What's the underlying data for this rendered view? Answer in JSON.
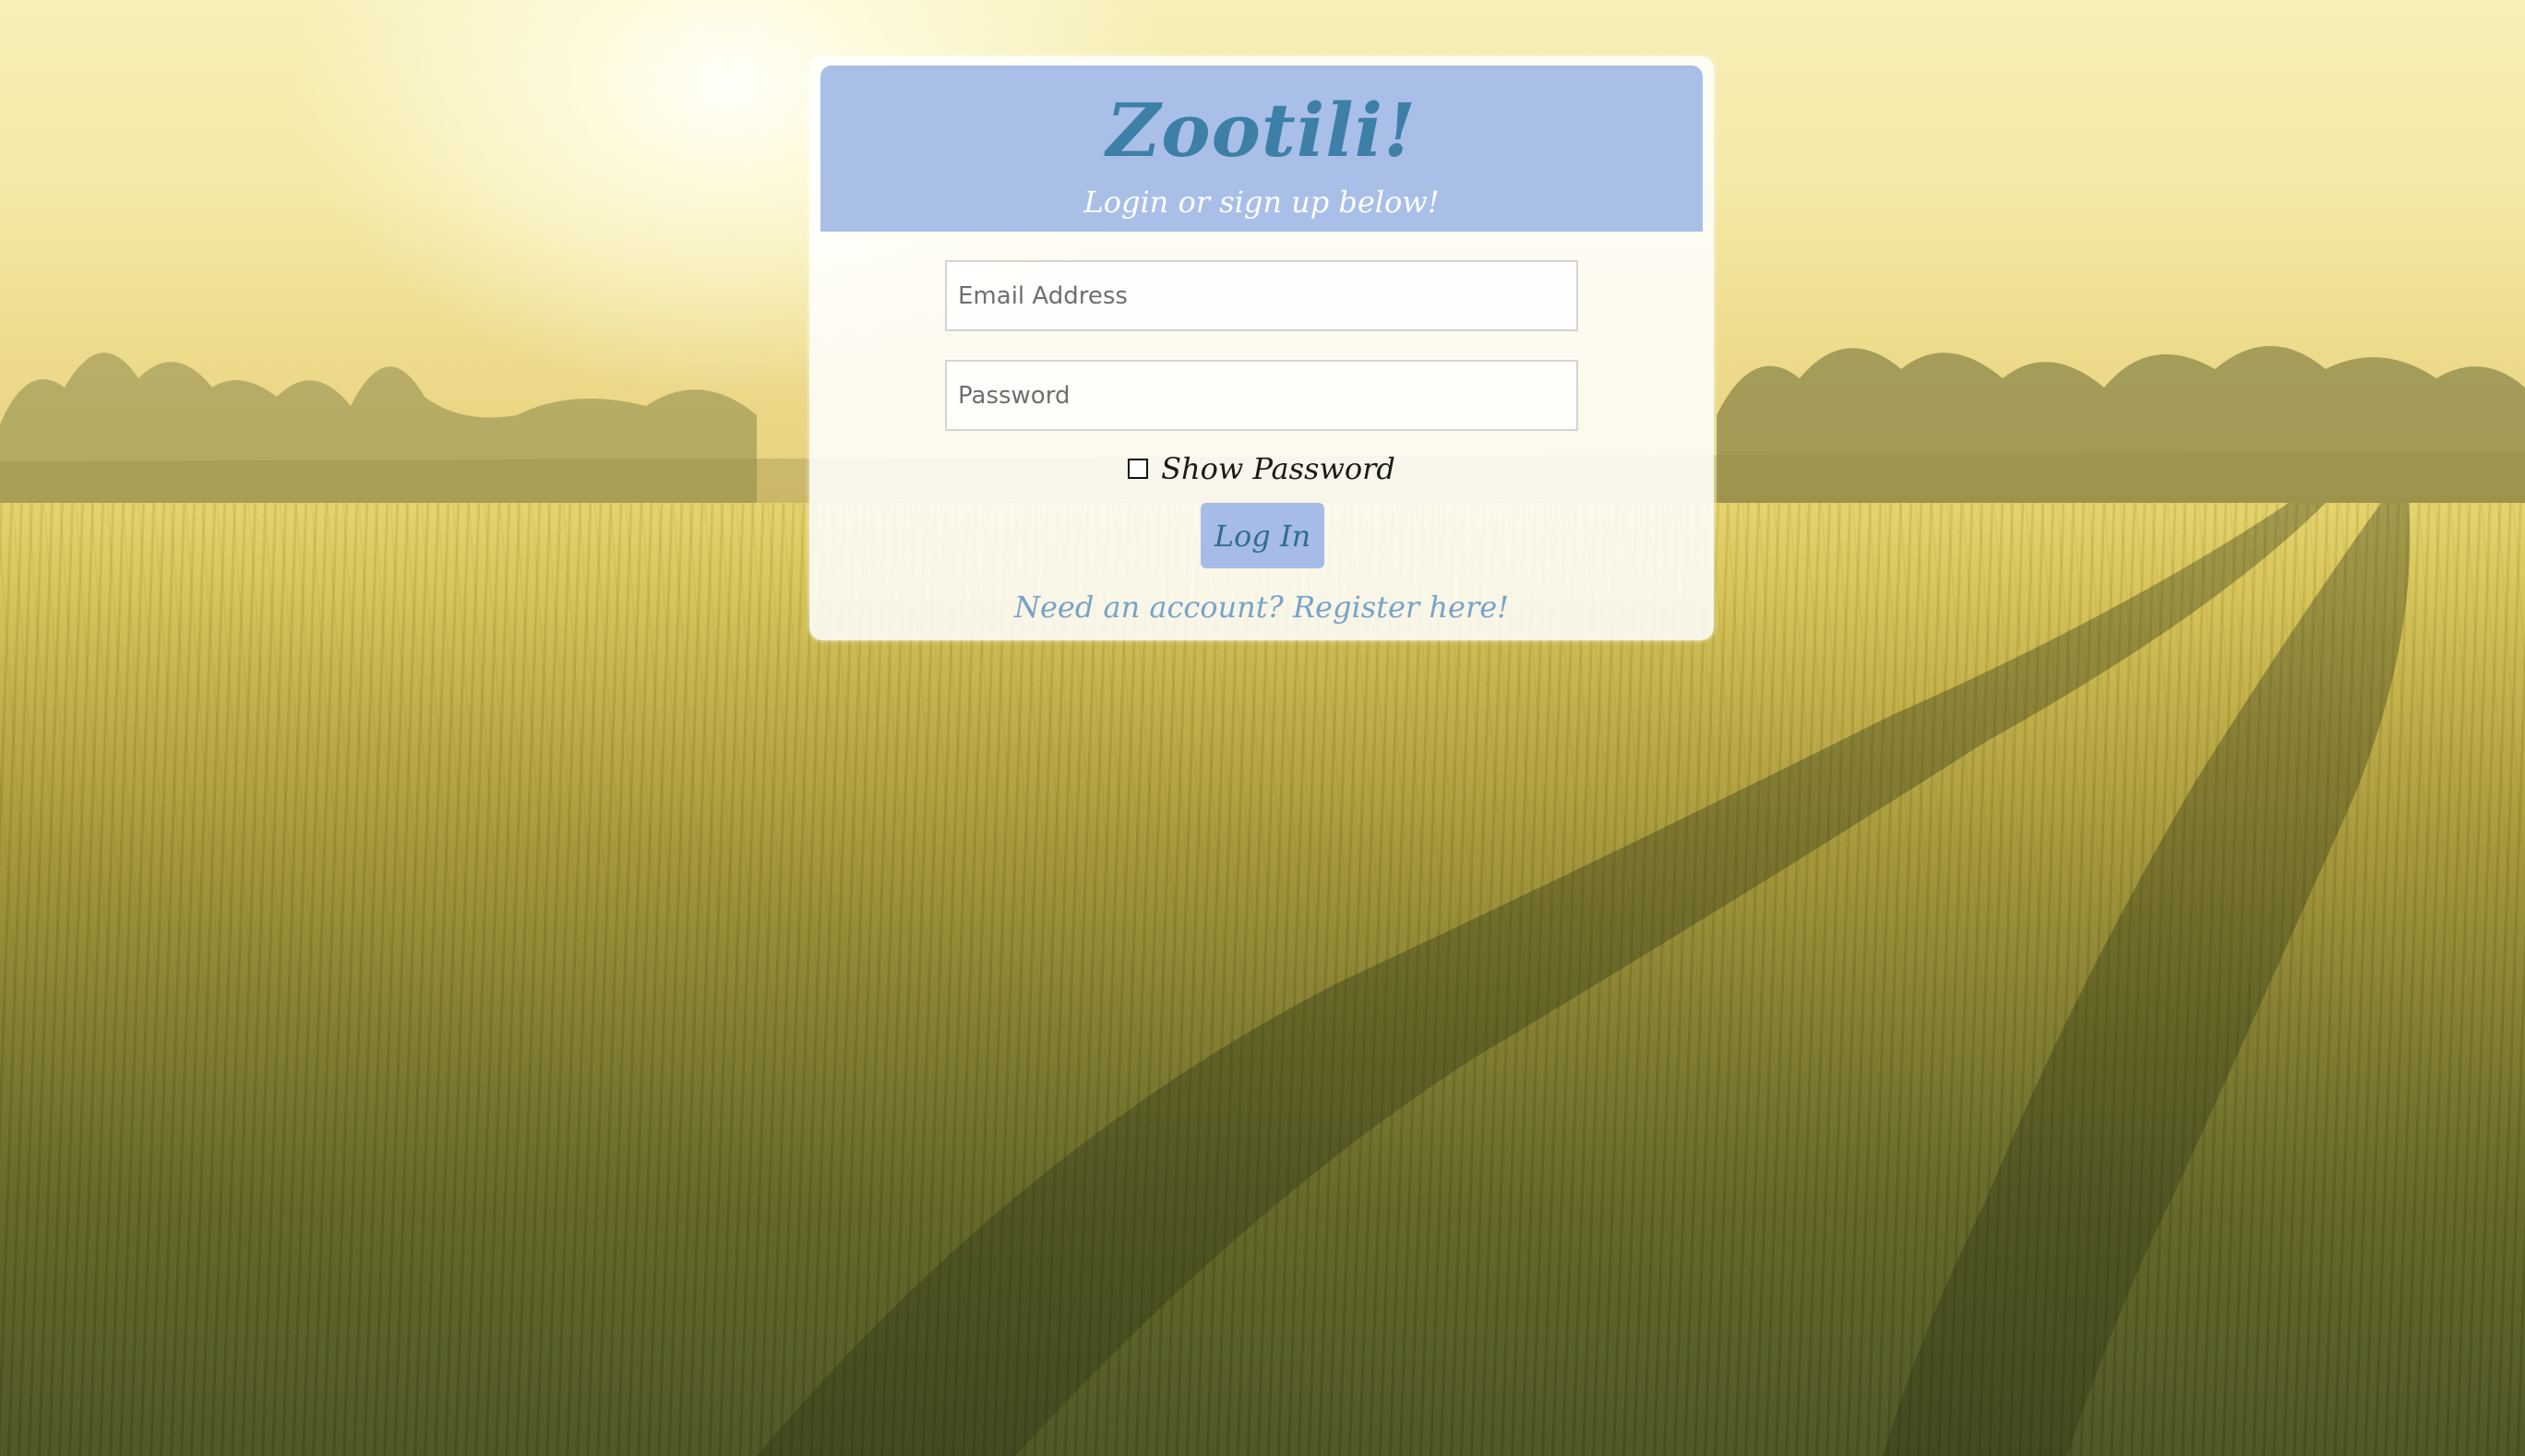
{
  "app": {
    "title": "Zootili!",
    "subtitle": "Login or sign up below!"
  },
  "form": {
    "email_placeholder": "Email Address",
    "email_value": "",
    "password_placeholder": "Password",
    "password_value": "",
    "show_password_label": "Show Password",
    "show_password_checked": false,
    "login_label": "Log In",
    "register_text": "Need an account? Register here!"
  },
  "colors": {
    "header_background": "#a9bfe8",
    "title": "#3d7fa6",
    "button_background": "#a6bce6",
    "button_text": "#2f6d92",
    "link": "#76a3c9"
  },
  "icons": {
    "checkbox": "checkbox-unchecked-icon"
  }
}
